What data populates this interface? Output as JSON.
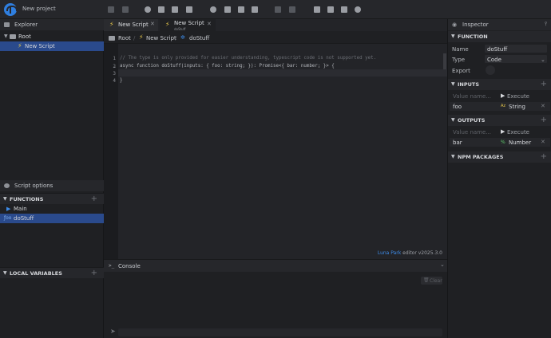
{
  "topbar": {
    "project_name": "New project"
  },
  "explorer": {
    "title": "Explorer",
    "tree": [
      {
        "label": "Root"
      },
      {
        "label": "New Script"
      }
    ]
  },
  "script_options": {
    "title": "Script options",
    "functions_header": "FUNCTIONS",
    "functions": [
      "Main",
      "doStuff"
    ],
    "local_vars_header": "LOCAL VARIABLES"
  },
  "tabs": [
    {
      "label": "New Script",
      "sub": ""
    },
    {
      "label": "New Script",
      "sub": "doStuff"
    }
  ],
  "breadcrumb": [
    "Root",
    "New Script",
    "doStuff"
  ],
  "editor": {
    "lines": [
      {
        "n": "1",
        "code": "// The type is only provided for easier understanding, typescript code is not supported yet."
      },
      {
        "n": "2",
        "code": "async function doStuff(inputs: { foo: string; }): Promise<{ bar: number; }> {"
      },
      {
        "n": "3",
        "code": ""
      },
      {
        "n": "4",
        "code": "}"
      }
    ],
    "footer_brand": "Luna Park",
    "footer_rest": " editor v2025.3.0"
  },
  "console": {
    "title": "Console",
    "clear_label": "Clear"
  },
  "inspector": {
    "title": "Inspector",
    "function_header": "FUNCTION",
    "name_label": "Name",
    "name_value": "doStuff",
    "type_label": "Type",
    "type_value": "Code",
    "export_label": "Export",
    "inputs_header": "INPUTS",
    "value_name_placeholder": "Value name...",
    "execute_label": "Execute",
    "inputs": [
      {
        "name": "foo",
        "type": "String",
        "type_icon": "Az"
      }
    ],
    "outputs_header": "OUTPUTS",
    "outputs": [
      {
        "name": "bar",
        "type": "Number",
        "type_icon": "%"
      }
    ],
    "npm_header": "NPM PACKAGES"
  },
  "colors": {
    "accent": "#2f7fe0",
    "selection": "#2a4a8c",
    "bolt": "#e8c84a"
  }
}
